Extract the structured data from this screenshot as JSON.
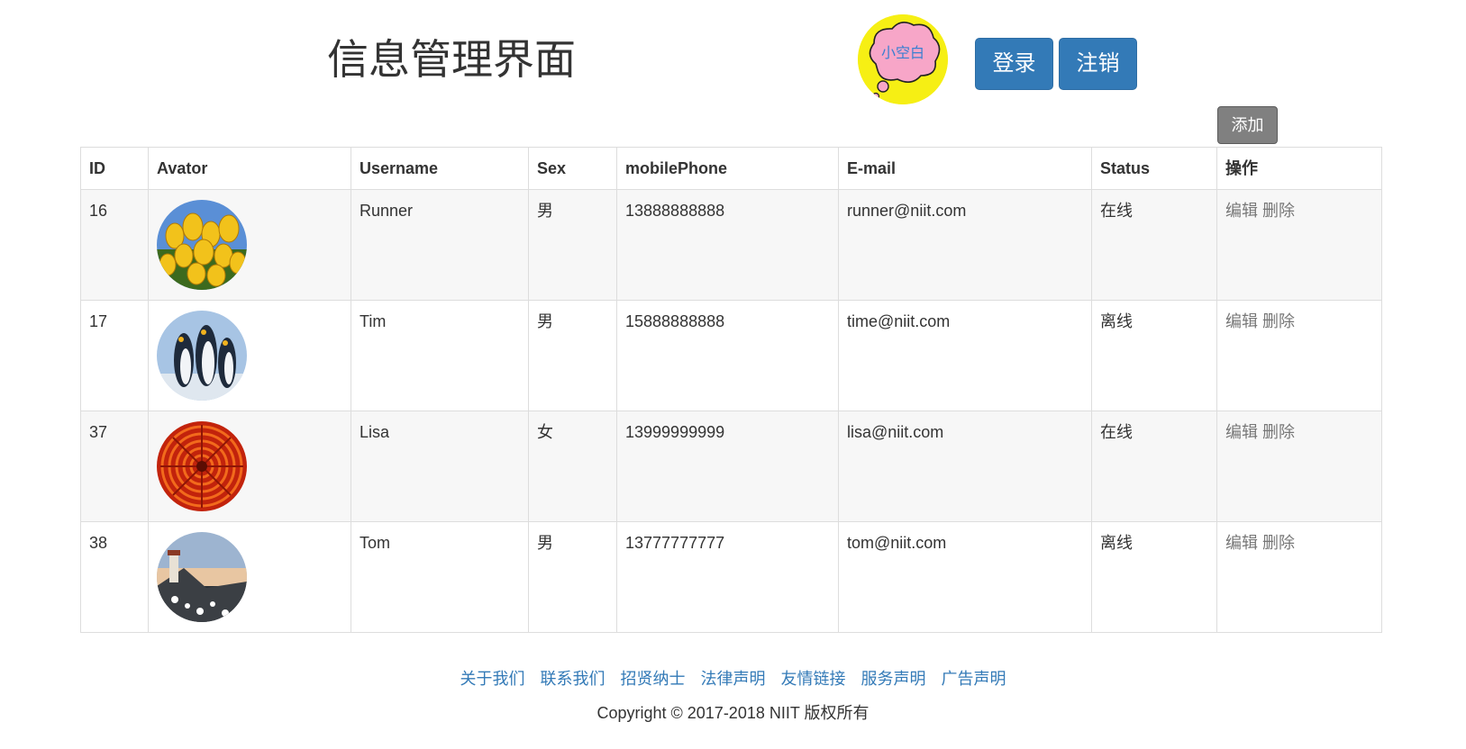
{
  "header": {
    "title": "信息管理界面",
    "logo_text": "小空白",
    "login_label": "登录",
    "logout_label": "注销",
    "add_label": "添加"
  },
  "table": {
    "columns": [
      "ID",
      "Avator",
      "Username",
      "Sex",
      "mobilePhone",
      "E-mail",
      "Status",
      "操作"
    ],
    "rows": [
      {
        "id": "16",
        "avatar": "tulips",
        "username": "Runner",
        "sex": "男",
        "phone": "13888888888",
        "email": "runner@niit.com",
        "status": "在线",
        "edit": "编辑",
        "delete": "删除"
      },
      {
        "id": "17",
        "avatar": "penguins",
        "username": "Tim",
        "sex": "男",
        "phone": "15888888888",
        "email": "time@niit.com",
        "status": "离线",
        "edit": "编辑",
        "delete": "删除"
      },
      {
        "id": "37",
        "avatar": "chrysanthemum",
        "username": "Lisa",
        "sex": "女",
        "phone": "13999999999",
        "email": "lisa@niit.com",
        "status": "在线",
        "edit": "编辑",
        "delete": "删除"
      },
      {
        "id": "38",
        "avatar": "lighthouse",
        "username": "Tom",
        "sex": "男",
        "phone": "13777777777",
        "email": "tom@niit.com",
        "status": "离线",
        "edit": "编辑",
        "delete": "删除"
      }
    ]
  },
  "footer": {
    "links": [
      "关于我们",
      "联系我们",
      "招贤纳士",
      "法律声明",
      "友情链接",
      "服务声明",
      "广告声明"
    ],
    "copyright": "Copyright © 2017-2018 NIIT 版权所有"
  },
  "colors": {
    "primary": "#337ab7",
    "add_button": "#808080",
    "logo_bg": "#f6ef14",
    "logo_cloud": "#f7a6c8",
    "striped_row": "#f7f7f7"
  }
}
